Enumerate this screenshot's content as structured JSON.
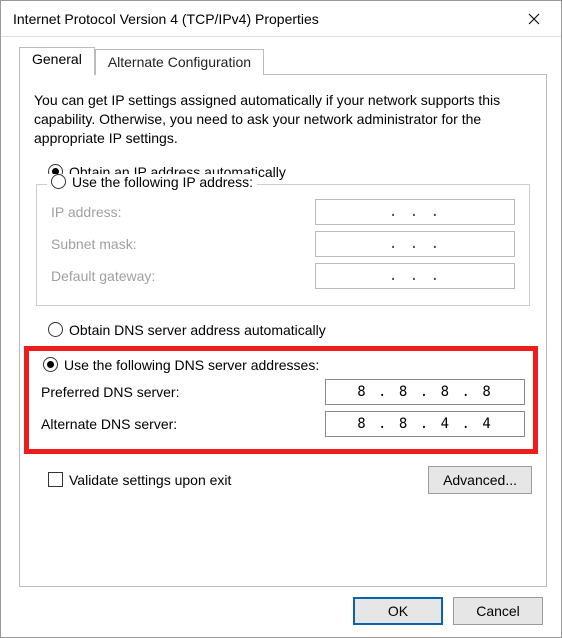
{
  "window": {
    "title": "Internet Protocol Version 4 (TCP/IPv4) Properties"
  },
  "tabs": {
    "general": "General",
    "alternate": "Alternate Configuration"
  },
  "description": "You can get IP settings assigned automatically if your network supports this capability. Otherwise, you need to ask your network administrator for the appropriate IP settings.",
  "ip": {
    "auto_label": "Obtain an IP address automatically",
    "manual_label": "Use the following IP address:",
    "auto_selected": true,
    "fields": {
      "address_label": "IP address:",
      "mask_label": "Subnet mask:",
      "gateway_label": "Default gateway:",
      "address_value": ".       .       .",
      "mask_value": ".       .       .",
      "gateway_value": ".       .       ."
    }
  },
  "dns": {
    "auto_label": "Obtain DNS server address automatically",
    "manual_label": "Use the following DNS server addresses:",
    "manual_selected": true,
    "fields": {
      "preferred_label": "Preferred DNS server:",
      "alternate_label": "Alternate DNS server:",
      "preferred_value": "8 . 8 . 8 . 8",
      "alternate_value": "8 . 8 . 4 . 4"
    }
  },
  "validate_label": "Validate settings upon exit",
  "buttons": {
    "advanced": "Advanced...",
    "ok": "OK",
    "cancel": "Cancel"
  }
}
